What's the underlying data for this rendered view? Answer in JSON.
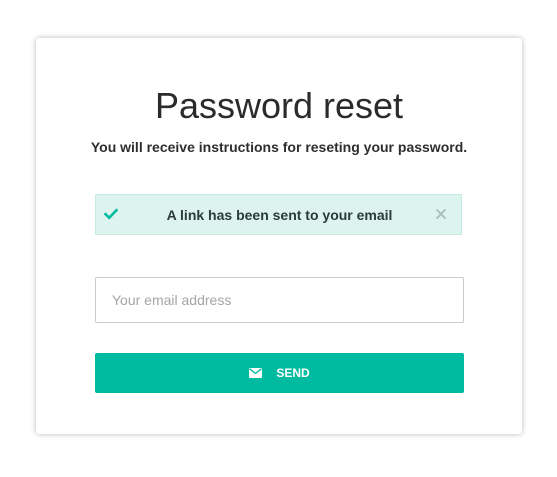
{
  "title": "Password reset",
  "subtitle": "You will receive instructions for reseting your password.",
  "alert": {
    "message": "A link has been sent to your email",
    "status_icon": "check-icon",
    "close_icon": "close-icon"
  },
  "email_field": {
    "placeholder": "Your email address",
    "value": ""
  },
  "send_button": {
    "label": "SEND",
    "icon": "envelope-icon"
  },
  "colors": {
    "accent": "#00bb9f",
    "alert_bg": "#dcf3ee",
    "title_text": "#2b2b2b"
  }
}
